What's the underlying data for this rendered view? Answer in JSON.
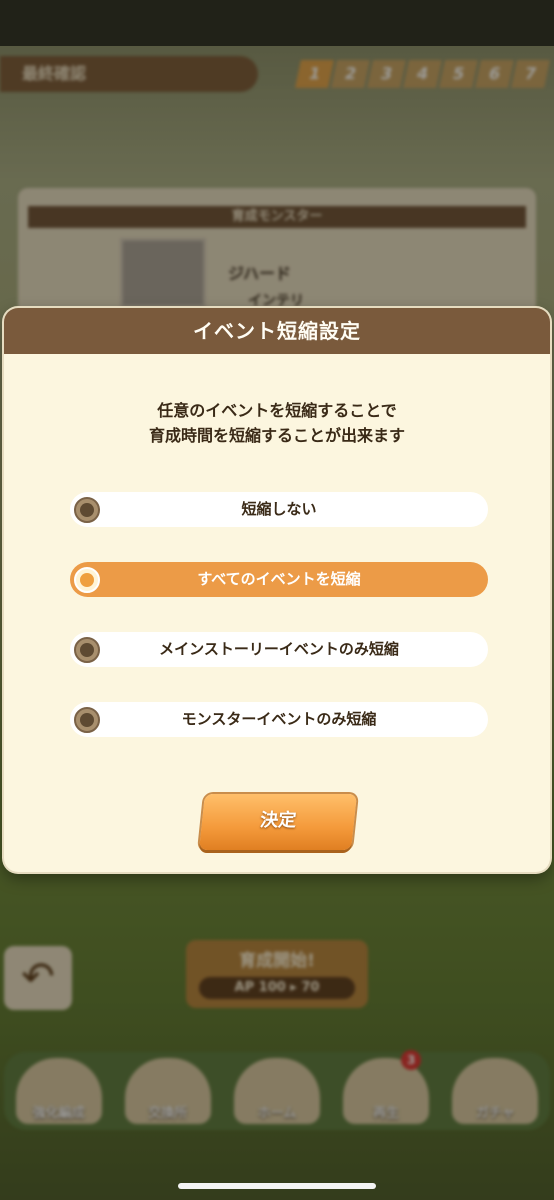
{
  "background": {
    "top_bar_title": "最終確認",
    "steps": [
      "1",
      "2",
      "3",
      "4",
      "5",
      "6",
      "7"
    ],
    "card_title": "育成モンスター",
    "monster_name": "ジハード",
    "monster_sub": "インテリ",
    "start_button": {
      "label": "育成開始!",
      "ap": "AP 100 ▸ 70"
    },
    "back_icon": "↶",
    "nav": [
      {
        "label": "強化編成"
      },
      {
        "label": "交換所"
      },
      {
        "label": "ホーム"
      },
      {
        "label": "再生",
        "badge": "3"
      },
      {
        "label": "ガチャ"
      }
    ]
  },
  "modal": {
    "title": "イベント短縮設定",
    "description_line1": "任意のイベントを短縮することで",
    "description_line2": "育成時間を短縮することが出来ます",
    "options": [
      {
        "label": "短縮しない",
        "selected": false
      },
      {
        "label": "すべてのイベントを短縮",
        "selected": true
      },
      {
        "label": "メインストーリーイベントのみ短縮",
        "selected": false
      },
      {
        "label": "モンスターイベントのみ短縮",
        "selected": false
      }
    ],
    "confirm_label": "決定"
  },
  "colors": {
    "header": "#7a5a3c",
    "selected_option": "#ec9b47",
    "panel": "#fcf6df",
    "confirm": "#f49a3b"
  }
}
